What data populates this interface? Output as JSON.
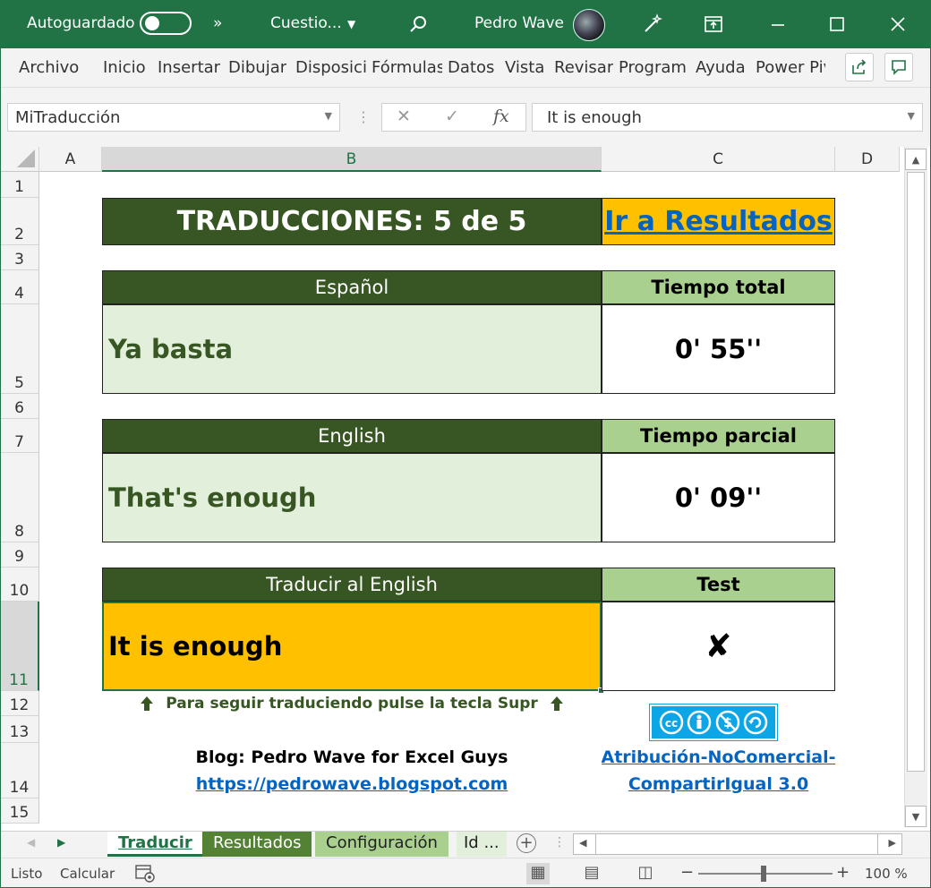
{
  "titlebar": {
    "autosave_label": "Autoguardado",
    "more": "»",
    "doc_title": "Cuestio...",
    "user_name": "Pedro Wave"
  },
  "ribbon": {
    "tabs": [
      "Archivo",
      "Inicio",
      "Insertar",
      "Dibujar",
      "Disposici",
      "Fórmulas",
      "Datos",
      "Vista",
      "Revisar",
      "Program",
      "Ayuda",
      "Power Piv"
    ]
  },
  "formula_bar": {
    "name_box": "MiTraducción",
    "cancel": "✕",
    "confirm": "✓",
    "fx": "fx",
    "value": "It is enough"
  },
  "columns": [
    "A",
    "B",
    "C",
    "D"
  ],
  "rows": [
    "1",
    "2",
    "3",
    "4",
    "5",
    "6",
    "7",
    "8",
    "9",
    "10",
    "11",
    "12",
    "13",
    "14",
    "15"
  ],
  "sheet": {
    "header_title": "TRADUCCIONES: 5 de 5",
    "results_link": "Ir a Resultados",
    "spanish_header": "Español",
    "spanish_text": "Ya basta",
    "total_time_header": "Tiempo total",
    "total_time": "0' 55''",
    "english_header": "English",
    "english_text": "That's enough",
    "partial_time_header": "Tiempo parcial",
    "partial_time": "0' 09''",
    "translate_header": "Traducir al English",
    "translate_input": "It is enough",
    "test_header": "Test",
    "test_result": "✘",
    "hint": "Para seguir traduciendo pulse la tecla Supr",
    "blog_label": "Blog: Pedro Wave for Excel Guys",
    "blog_url": "https://pedrowave.blogspot.com",
    "license_line1": "Atribución-NoComercial-",
    "license_line2": "CompartirIgual 3.0"
  },
  "sheet_tabs": {
    "items": [
      "Traducir",
      "Resultados",
      "Configuración",
      "Id ..."
    ]
  },
  "status": {
    "ready": "Listo",
    "calc": "Calcular",
    "zoom": "100 %"
  },
  "colors": {
    "excel_green": "#217346",
    "dark_green": "#375623",
    "light_green": "#a9d08e",
    "pale_green": "#e2efda",
    "orange": "#ffc000",
    "link_blue": "#0563c1",
    "cc_blue": "#0ca6e6"
  }
}
